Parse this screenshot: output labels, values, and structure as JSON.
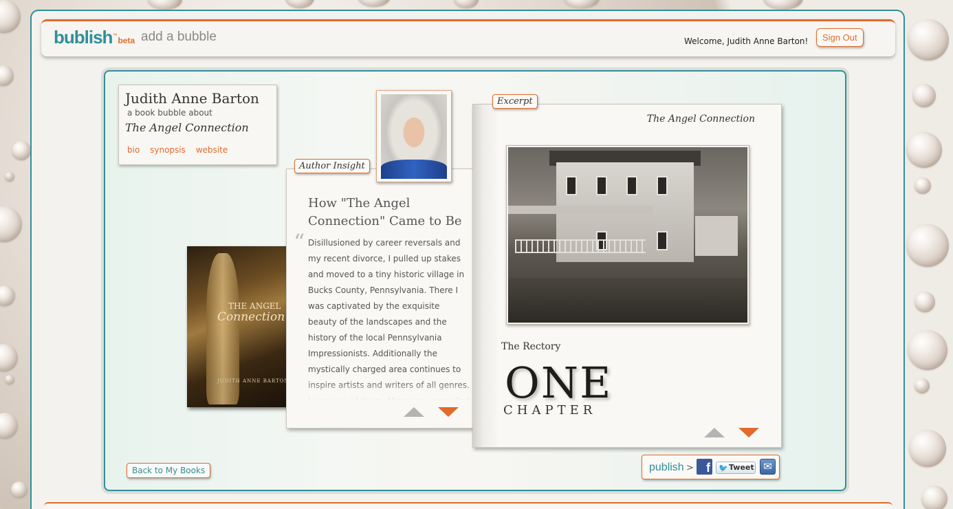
{
  "header": {
    "logo": "bublish",
    "logo_tm": "™",
    "logo_beta": "beta",
    "page_title": "add a bubble",
    "welcome": "Welcome, Judith Anne Barton!",
    "sign_out": "Sign Out"
  },
  "book_card": {
    "author": "Judith Anne Barton",
    "about": "a book bubble about",
    "title": "The Angel Connection",
    "links": [
      "bio",
      "synopsis",
      "website"
    ]
  },
  "cover": {
    "title_line1": "THE ANGEL",
    "title_line2": "Connection",
    "author": "JUDITH ANNE BARTON"
  },
  "insight": {
    "tag": "Author Insight",
    "heading": "How \"The Angel Connection\" Came to Be",
    "quote_mark": "“",
    "body": "Disillusioned by career reversals and my recent divorce, I pulled up stakes and moved to a tiny historic village in Bucks County, Pennsylvania. There I was captivated by the exquisite beauty of the landscapes and the history of the local Pennsylvania Impressionists. Additionally the mystically charged area continues to inspire artists and writers of all genres. I was one of them. My muse compelled me to write"
  },
  "excerpt": {
    "tag": "Excerpt",
    "book_title": "The Angel Connection",
    "caption": "The Rectory",
    "chapter_number": "ONE",
    "chapter_word": "CHAPTER"
  },
  "footer": {
    "back": "Back to My Books",
    "publish": "publish",
    "publish_arrow": ">",
    "facebook": "f",
    "tweet": "Tweet",
    "mail": "✉"
  },
  "colors": {
    "teal": "#2e8f9a",
    "orange": "#e26a2c"
  }
}
